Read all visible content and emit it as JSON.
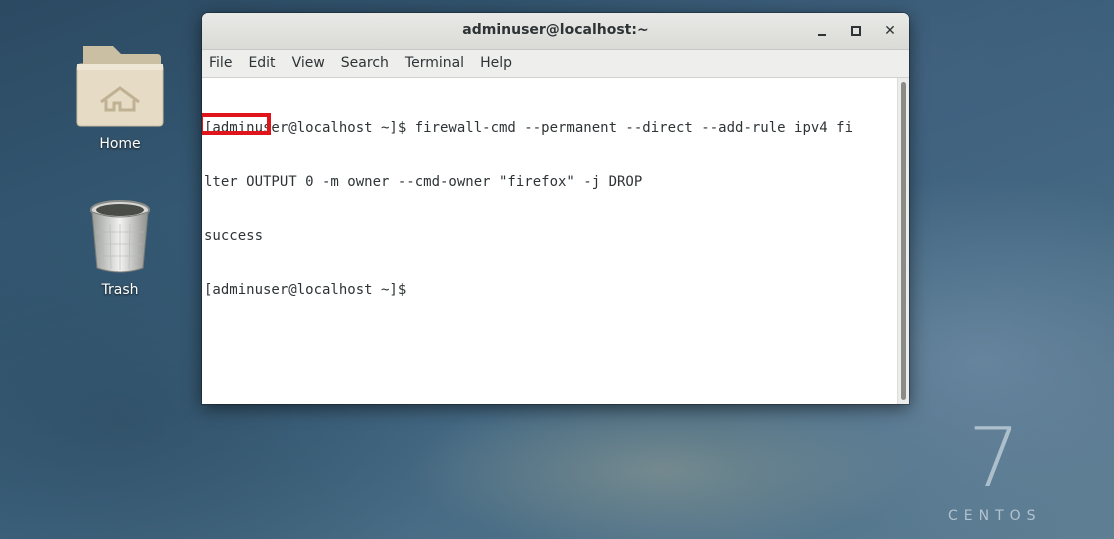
{
  "desktop": {
    "icons": [
      {
        "label": "Home",
        "icon": "folder-home-icon"
      },
      {
        "label": "Trash",
        "icon": "trash-icon"
      }
    ],
    "os_logo": {
      "version": "7",
      "name": "CENTOS"
    }
  },
  "window": {
    "title": "adminuser@localhost:~",
    "controls": {
      "minimize": "minimize",
      "maximize": "maximize",
      "close": "✕"
    },
    "menu": [
      "File",
      "Edit",
      "View",
      "Search",
      "Terminal",
      "Help"
    ]
  },
  "terminal": {
    "lines": [
      "[adminuser@localhost ~]$ firewall-cmd --permanent --direct --add-rule ipv4 fi",
      "lter OUTPUT 0 -m owner --cmd-owner \"firefox\" -j DROP",
      "success",
      "[adminuser@localhost ~]$ "
    ]
  },
  "colors": {
    "highlight": "#e0151b",
    "terminal_fg": "#2e3436",
    "terminal_bg": "#ffffff"
  }
}
